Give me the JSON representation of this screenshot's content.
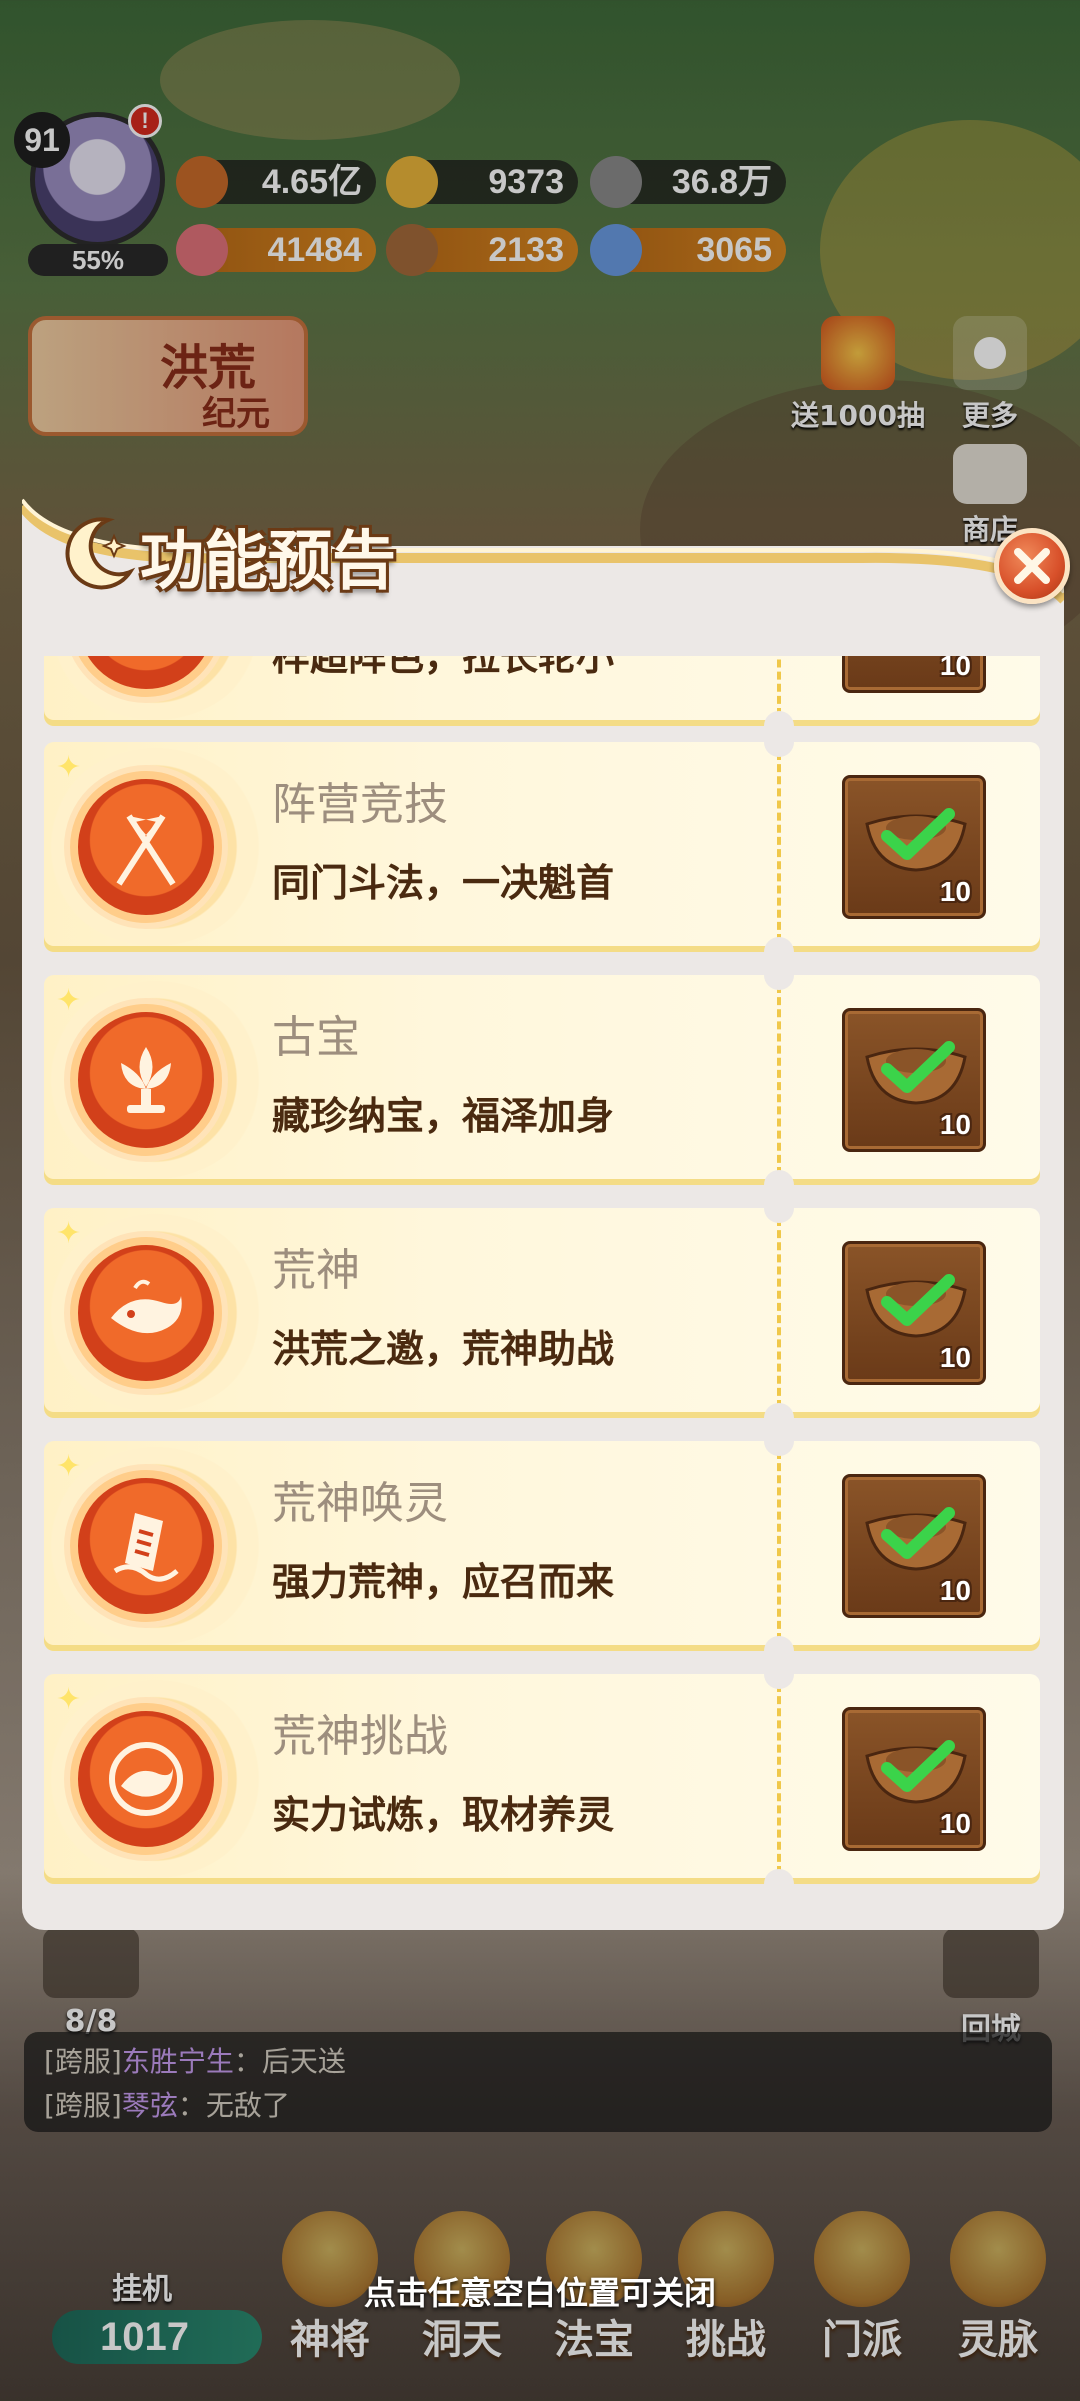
{
  "hud": {
    "level": "91",
    "exp_percent": "55%",
    "alert_mark": "!",
    "resources": [
      {
        "icon": "power-icon",
        "value": "4.65亿"
      },
      {
        "icon": "gold-ingot-icon",
        "value": "9373"
      },
      {
        "icon": "coin-icon",
        "value": "36.8万"
      },
      {
        "icon": "meat-icon",
        "value": "41484"
      },
      {
        "icon": "wood-icon",
        "value": "2133"
      },
      {
        "icon": "crystal-icon",
        "value": "3065"
      }
    ],
    "banner": {
      "title": "洪荒",
      "subtitle": "纪元"
    },
    "side_buttons": [
      {
        "label": "送1000抽",
        "icon": "gift-icon"
      },
      {
        "label": "更多",
        "icon": "flower-icon"
      },
      {
        "label": "商店",
        "icon": "shop-icon"
      }
    ]
  },
  "modal": {
    "title": "功能预告",
    "close_icon": "close-icon",
    "items": [
      {
        "name": "",
        "desc": "样超阵色，拉长轮小",
        "icon": "partial-icon",
        "reward_qty": "10"
      },
      {
        "name": "阵营竞技",
        "desc": "同门斗法，一决魁首",
        "icon": "crossed-flags-icon",
        "reward_qty": "10"
      },
      {
        "name": "古宝",
        "desc": "藏珍纳宝，福泽加身",
        "icon": "lotus-icon",
        "reward_qty": "10"
      },
      {
        "name": "荒神",
        "desc": "洪荒之邀，荒神助战",
        "icon": "whale-icon",
        "reward_qty": "10"
      },
      {
        "name": "荒神唤灵",
        "desc": "强力荒神，应召而来",
        "icon": "talisman-icon",
        "reward_qty": "10"
      },
      {
        "name": "荒神挑战",
        "desc": "实力试炼，取材养灵",
        "icon": "whale-emblem-icon",
        "reward_qty": "10"
      }
    ]
  },
  "bottom": {
    "left_counter": "8/8",
    "return_city": "回城",
    "chat": [
      {
        "channel": "[跨服]",
        "name": "东胜宁生",
        "sep": "：",
        "text": "后天送"
      },
      {
        "channel": "[跨服]",
        "name": "琴弦",
        "sep": "：",
        "text": "无敌了"
      }
    ],
    "close_hint": "点击任意空白位置可关闭",
    "idle_label": "挂机",
    "idle_value": "1017",
    "tabs": [
      "神将",
      "洞天",
      "法宝",
      "挑战",
      "门派",
      "灵脉"
    ]
  },
  "colors": {
    "accent": "#e0622a",
    "card_bg": "#fff7dc",
    "title_outline": "#6b3a15",
    "check_green": "#3bd34a"
  }
}
